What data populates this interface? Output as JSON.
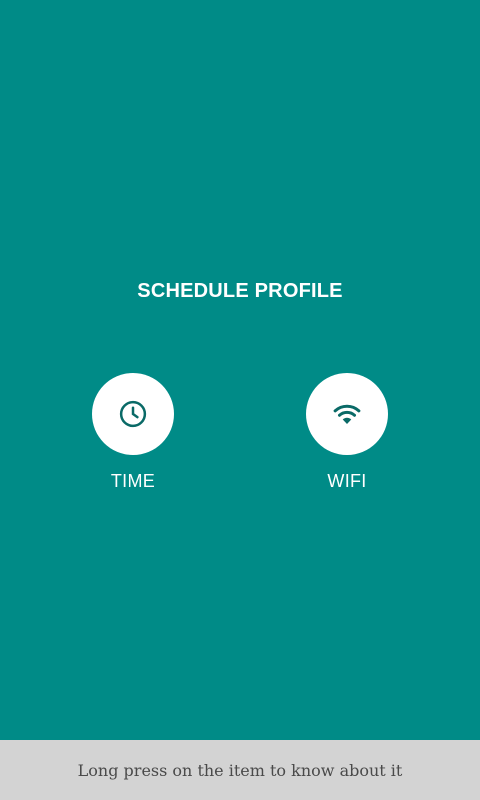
{
  "title": "SCHEDULE PROFILE",
  "options": [
    {
      "label": "TIME",
      "icon": "clock-icon"
    },
    {
      "label": "WIFI",
      "icon": "wifi-icon"
    }
  ],
  "hint": "Long press on the item to know about it",
  "colors": {
    "background": "#008b87",
    "icon": "#0a6a67",
    "circle": "#ffffff",
    "hint_bar": "#d3d3d3"
  }
}
